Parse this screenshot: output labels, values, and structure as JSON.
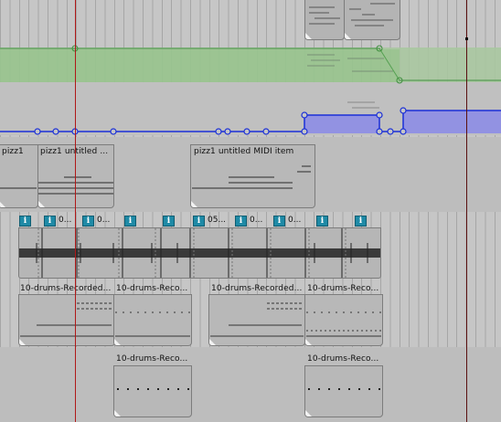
{
  "arrange": {
    "track_envelope_green": "#3f8f3f",
    "track_envelope_blue": "#1a2fd8",
    "items_row_midi": {
      "label_a": "pizz1",
      "label_b": "pizz1 untitled ...",
      "label_c": "pizz1 untitled MIDI item"
    },
    "items_row_audio": {
      "info_icon": "i",
      "take_labels": [
        "0...",
        "0...",
        "05...",
        "0...",
        "0..."
      ]
    },
    "items_row_drums": {
      "labels": [
        "10-drums-Recorded...",
        "10-drums-Reco...",
        "10-drums-Recorded...",
        "10-drums-Reco..."
      ]
    },
    "items_row_drums2": {
      "labels": [
        "10-drums-Reco...",
        "10-drums-Reco..."
      ]
    }
  }
}
